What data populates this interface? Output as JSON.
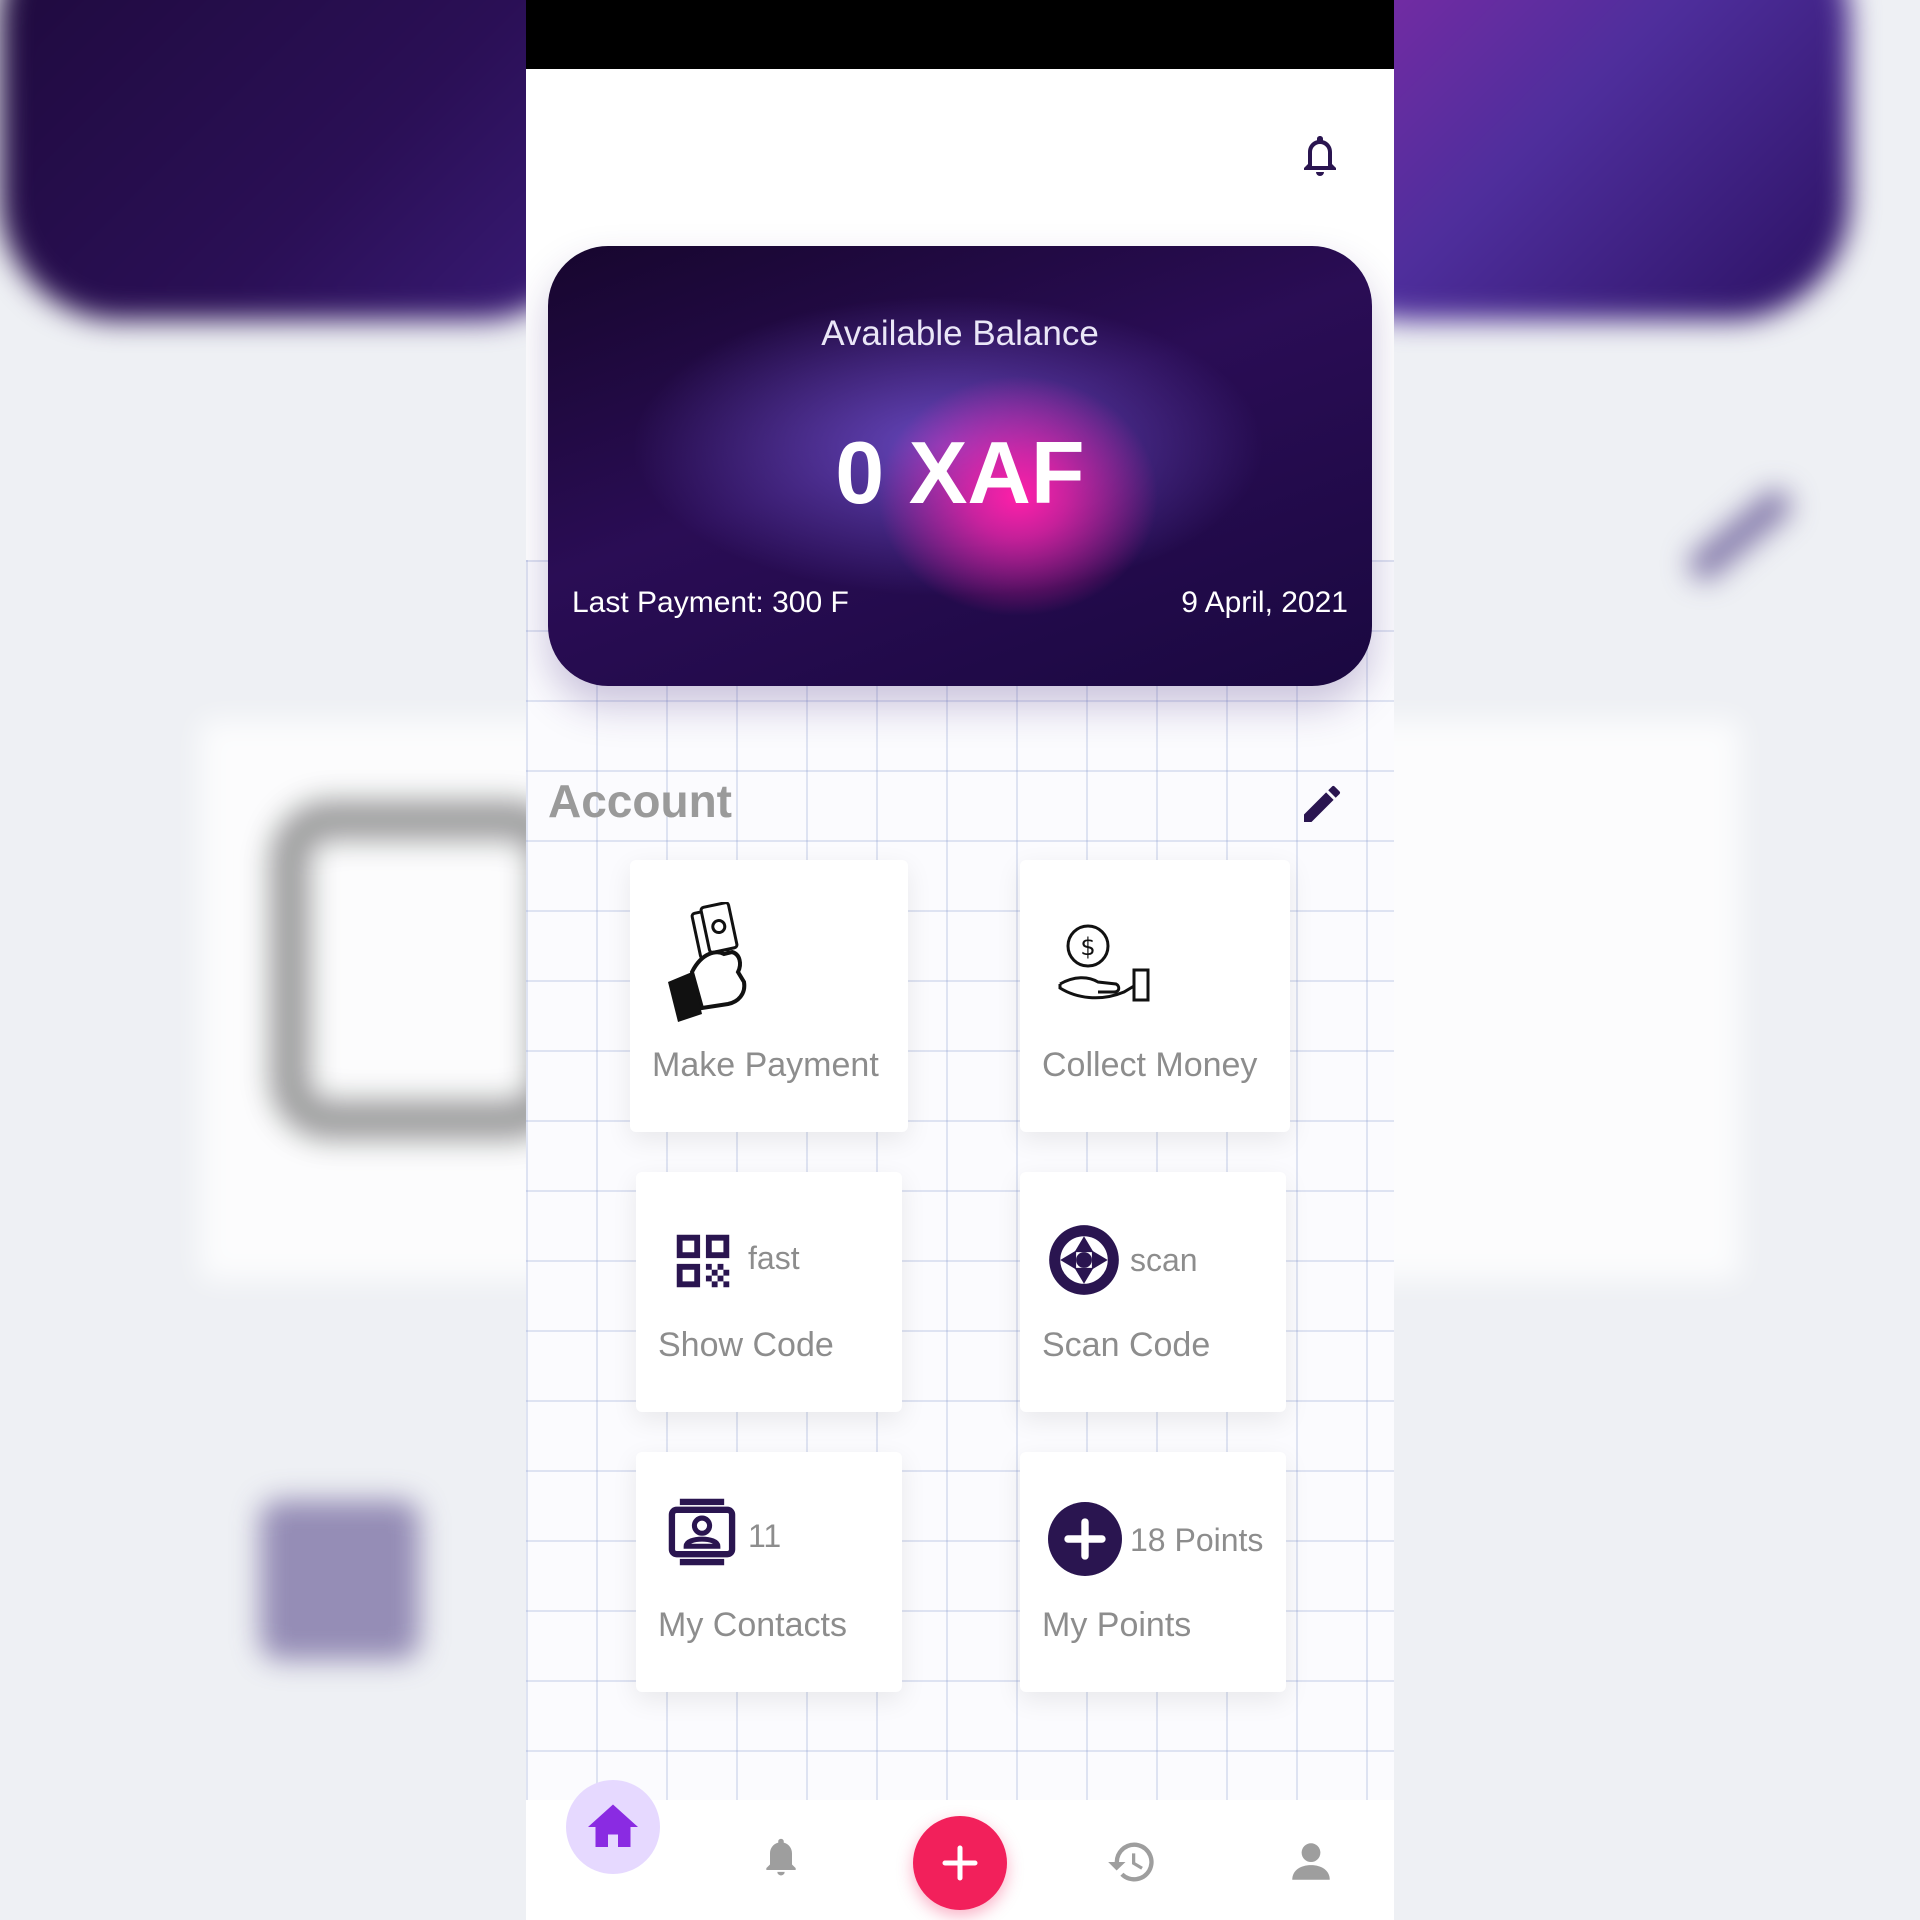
{
  "header": {
    "notification_icon": "bell-icon"
  },
  "balance_card": {
    "title": "Available Balance",
    "amount": "0 XAF",
    "last_payment": "Last Payment: 300 F",
    "date": "9 April, 2021"
  },
  "account": {
    "title": "Account",
    "edit_icon": "pencil-icon",
    "tiles": [
      {
        "label": "Make Payment",
        "extra": "",
        "icon": "hand-money-icon"
      },
      {
        "label": "Collect Money",
        "extra": "",
        "icon": "hand-coin-icon"
      },
      {
        "label": "Show Code",
        "extra": "fast",
        "icon": "qr-code-icon"
      },
      {
        "label": "Scan Code",
        "extra": "scan",
        "icon": "camera-shutter-icon"
      },
      {
        "label": "My Contacts",
        "extra": "11",
        "icon": "contacts-icon"
      },
      {
        "label": "My Points",
        "extra": "18 Points",
        "icon": "plus-circle-icon"
      }
    ]
  },
  "bottom_nav": {
    "items": [
      "home-icon",
      "bell-icon",
      "add-icon",
      "history-icon",
      "profile-icon"
    ]
  },
  "colors": {
    "accent": "#f2205b",
    "primary_dark": "#2a1550",
    "home_active": "#8a2be2"
  }
}
